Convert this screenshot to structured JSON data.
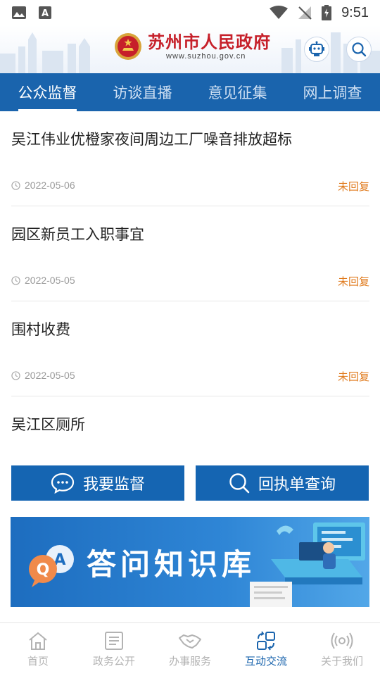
{
  "status_bar": {
    "time": "9:51"
  },
  "header": {
    "title": "苏州市人民政府",
    "subtitle": "www.suzhou.gov.cn"
  },
  "tabs": [
    {
      "label": "公众监督",
      "active": true
    },
    {
      "label": "访谈直播",
      "active": false
    },
    {
      "label": "意见征集",
      "active": false
    },
    {
      "label": "网上调查",
      "active": false
    }
  ],
  "items": [
    {
      "title": "吴江伟业优橙家夜间周边工厂噪音排放超标",
      "date": "2022-05-06",
      "status": "未回复"
    },
    {
      "title": "园区新员工入职事宜",
      "date": "2022-05-05",
      "status": "未回复"
    },
    {
      "title": "围村收费",
      "date": "2022-05-05",
      "status": "未回复"
    },
    {
      "title": "吴江区厕所"
    }
  ],
  "actions": {
    "supervise": "我要监督",
    "query": "回执单查询"
  },
  "banner": {
    "title": "答问知识库"
  },
  "bottom_nav": [
    {
      "label": "首页",
      "icon": "home-icon"
    },
    {
      "label": "政务公开",
      "icon": "document-icon"
    },
    {
      "label": "办事服务",
      "icon": "handshake-icon"
    },
    {
      "label": "互动交流",
      "icon": "interaction-icon",
      "active": true
    },
    {
      "label": "关于我们",
      "icon": "broadcast-icon"
    }
  ],
  "colors": {
    "brand_blue": "#1a64ad",
    "status_orange": "#e07a1c",
    "logo_red": "#c6202a"
  }
}
